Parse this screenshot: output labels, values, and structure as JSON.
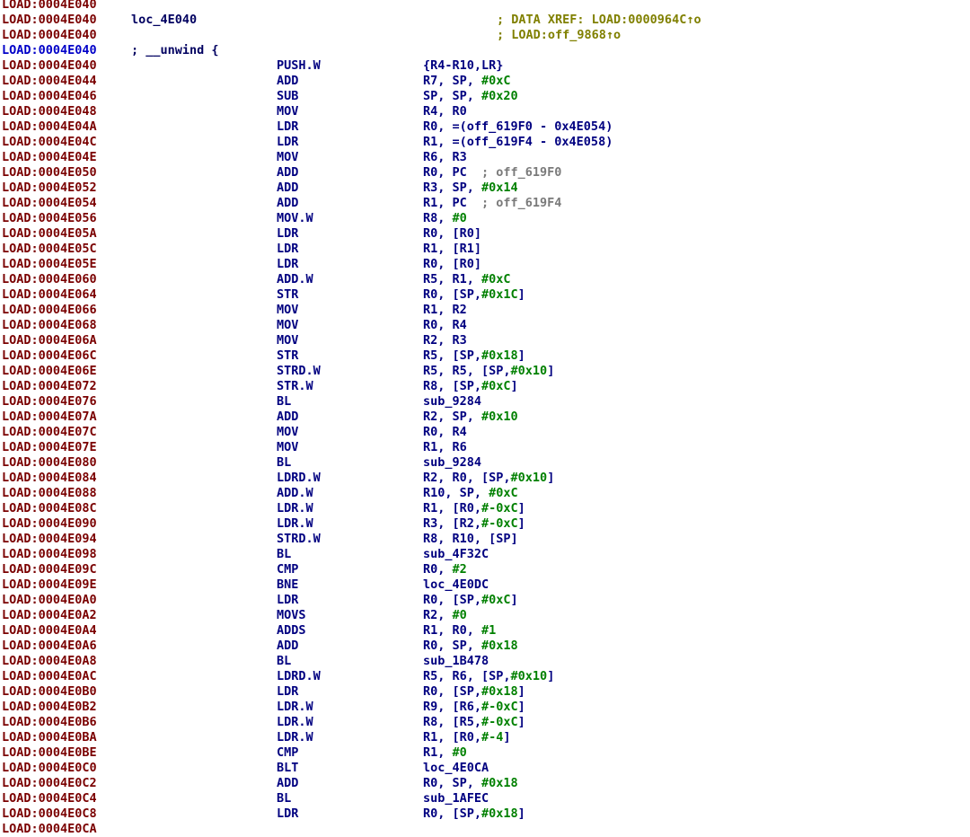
{
  "colors": {
    "address": "#7a0000",
    "address_highlighted": "#0000c8",
    "mnemonic": "#000080",
    "operand": "#000080",
    "immediate": "#008000",
    "comment": "#7a7a7a",
    "xref": "#808000",
    "background": "#ffffff"
  },
  "lines": [
    {
      "addr": "LOAD:0004E040"
    },
    {
      "addr": "LOAD:0004E040",
      "label": "loc_4E040",
      "xref": "; DATA XREF: LOAD:0000964C↑o"
    },
    {
      "addr": "LOAD:0004E040",
      "xref": "; LOAD:off_9868↑o"
    },
    {
      "addr": "LOAD:0004E040",
      "highlight": true,
      "label": "; __unwind {"
    },
    {
      "addr": "LOAD:0004E040",
      "mnem": "PUSH.W",
      "ops": [
        {
          "t": "{R4-R10,LR}"
        }
      ]
    },
    {
      "addr": "LOAD:0004E044",
      "mnem": "ADD",
      "ops": [
        {
          "t": "R7, SP, "
        },
        {
          "t": "#0xC",
          "c": "num"
        }
      ]
    },
    {
      "addr": "LOAD:0004E046",
      "mnem": "SUB",
      "ops": [
        {
          "t": "SP, SP, "
        },
        {
          "t": "#0x20",
          "c": "num"
        }
      ]
    },
    {
      "addr": "LOAD:0004E048",
      "mnem": "MOV",
      "ops": [
        {
          "t": "R4, R0"
        }
      ]
    },
    {
      "addr": "LOAD:0004E04A",
      "mnem": "LDR",
      "ops": [
        {
          "t": "R0, =(off_619F0 - 0x4E054)"
        }
      ]
    },
    {
      "addr": "LOAD:0004E04C",
      "mnem": "LDR",
      "ops": [
        {
          "t": "R1, =(off_619F4 - 0x4E058)"
        }
      ]
    },
    {
      "addr": "LOAD:0004E04E",
      "mnem": "MOV",
      "ops": [
        {
          "t": "R6, R3"
        }
      ]
    },
    {
      "addr": "LOAD:0004E050",
      "mnem": "ADD",
      "ops": [
        {
          "t": "R0, PC  "
        },
        {
          "t": "; off_619F0",
          "c": "cmt"
        }
      ]
    },
    {
      "addr": "LOAD:0004E052",
      "mnem": "ADD",
      "ops": [
        {
          "t": "R3, SP, "
        },
        {
          "t": "#0x14",
          "c": "num"
        }
      ]
    },
    {
      "addr": "LOAD:0004E054",
      "mnem": "ADD",
      "ops": [
        {
          "t": "R1, PC  "
        },
        {
          "t": "; off_619F4",
          "c": "cmt"
        }
      ]
    },
    {
      "addr": "LOAD:0004E056",
      "mnem": "MOV.W",
      "ops": [
        {
          "t": "R8, "
        },
        {
          "t": "#0",
          "c": "num"
        }
      ]
    },
    {
      "addr": "LOAD:0004E05A",
      "mnem": "LDR",
      "ops": [
        {
          "t": "R0, [R0]"
        }
      ]
    },
    {
      "addr": "LOAD:0004E05C",
      "mnem": "LDR",
      "ops": [
        {
          "t": "R1, [R1]"
        }
      ]
    },
    {
      "addr": "LOAD:0004E05E",
      "mnem": "LDR",
      "ops": [
        {
          "t": "R0, [R0]"
        }
      ]
    },
    {
      "addr": "LOAD:0004E060",
      "mnem": "ADD.W",
      "ops": [
        {
          "t": "R5, R1, "
        },
        {
          "t": "#0xC",
          "c": "num"
        }
      ]
    },
    {
      "addr": "LOAD:0004E064",
      "mnem": "STR",
      "ops": [
        {
          "t": "R0, [SP,"
        },
        {
          "t": "#0x1C",
          "c": "num"
        },
        {
          "t": "]"
        }
      ]
    },
    {
      "addr": "LOAD:0004E066",
      "mnem": "MOV",
      "ops": [
        {
          "t": "R1, R2"
        }
      ]
    },
    {
      "addr": "LOAD:0004E068",
      "mnem": "MOV",
      "ops": [
        {
          "t": "R0, R4"
        }
      ]
    },
    {
      "addr": "LOAD:0004E06A",
      "mnem": "MOV",
      "ops": [
        {
          "t": "R2, R3"
        }
      ]
    },
    {
      "addr": "LOAD:0004E06C",
      "mnem": "STR",
      "ops": [
        {
          "t": "R5, [SP,"
        },
        {
          "t": "#0x18",
          "c": "num"
        },
        {
          "t": "]"
        }
      ]
    },
    {
      "addr": "LOAD:0004E06E",
      "mnem": "STRD.W",
      "ops": [
        {
          "t": "R5, R5, [SP,"
        },
        {
          "t": "#0x10",
          "c": "num"
        },
        {
          "t": "]"
        }
      ]
    },
    {
      "addr": "LOAD:0004E072",
      "mnem": "STR.W",
      "ops": [
        {
          "t": "R8, [SP,"
        },
        {
          "t": "#0xC",
          "c": "num"
        },
        {
          "t": "]"
        }
      ]
    },
    {
      "addr": "LOAD:0004E076",
      "mnem": "BL",
      "ops": [
        {
          "t": "sub_9284"
        }
      ]
    },
    {
      "addr": "LOAD:0004E07A",
      "mnem": "ADD",
      "ops": [
        {
          "t": "R2, SP, "
        },
        {
          "t": "#0x10",
          "c": "num"
        }
      ]
    },
    {
      "addr": "LOAD:0004E07C",
      "mnem": "MOV",
      "ops": [
        {
          "t": "R0, R4"
        }
      ]
    },
    {
      "addr": "LOAD:0004E07E",
      "mnem": "MOV",
      "ops": [
        {
          "t": "R1, R6"
        }
      ]
    },
    {
      "addr": "LOAD:0004E080",
      "mnem": "BL",
      "ops": [
        {
          "t": "sub_9284"
        }
      ]
    },
    {
      "addr": "LOAD:0004E084",
      "mnem": "LDRD.W",
      "ops": [
        {
          "t": "R2, R0, [SP,"
        },
        {
          "t": "#0x10",
          "c": "num"
        },
        {
          "t": "]"
        }
      ]
    },
    {
      "addr": "LOAD:0004E088",
      "mnem": "ADD.W",
      "ops": [
        {
          "t": "R10, SP, "
        },
        {
          "t": "#0xC",
          "c": "num"
        }
      ]
    },
    {
      "addr": "LOAD:0004E08C",
      "mnem": "LDR.W",
      "ops": [
        {
          "t": "R1, [R0,"
        },
        {
          "t": "#-0xC",
          "c": "num"
        },
        {
          "t": "]"
        }
      ]
    },
    {
      "addr": "LOAD:0004E090",
      "mnem": "LDR.W",
      "ops": [
        {
          "t": "R3, [R2,"
        },
        {
          "t": "#-0xC",
          "c": "num"
        },
        {
          "t": "]"
        }
      ]
    },
    {
      "addr": "LOAD:0004E094",
      "mnem": "STRD.W",
      "ops": [
        {
          "t": "R8, R10, [SP]"
        }
      ]
    },
    {
      "addr": "LOAD:0004E098",
      "mnem": "BL",
      "ops": [
        {
          "t": "sub_4F32C"
        }
      ]
    },
    {
      "addr": "LOAD:0004E09C",
      "mnem": "CMP",
      "ops": [
        {
          "t": "R0, "
        },
        {
          "t": "#2",
          "c": "num"
        }
      ]
    },
    {
      "addr": "LOAD:0004E09E",
      "mnem": "BNE",
      "ops": [
        {
          "t": "loc_4E0DC"
        }
      ]
    },
    {
      "addr": "LOAD:0004E0A0",
      "mnem": "LDR",
      "ops": [
        {
          "t": "R0, [SP,"
        },
        {
          "t": "#0xC",
          "c": "num"
        },
        {
          "t": "]"
        }
      ]
    },
    {
      "addr": "LOAD:0004E0A2",
      "mnem": "MOVS",
      "ops": [
        {
          "t": "R2, "
        },
        {
          "t": "#0",
          "c": "num"
        }
      ]
    },
    {
      "addr": "LOAD:0004E0A4",
      "mnem": "ADDS",
      "ops": [
        {
          "t": "R1, R0, "
        },
        {
          "t": "#1",
          "c": "num"
        }
      ]
    },
    {
      "addr": "LOAD:0004E0A6",
      "mnem": "ADD",
      "ops": [
        {
          "t": "R0, SP, "
        },
        {
          "t": "#0x18",
          "c": "num"
        }
      ]
    },
    {
      "addr": "LOAD:0004E0A8",
      "mnem": "BL",
      "ops": [
        {
          "t": "sub_1B478"
        }
      ]
    },
    {
      "addr": "LOAD:0004E0AC",
      "mnem": "LDRD.W",
      "ops": [
        {
          "t": "R5, R6, [SP,"
        },
        {
          "t": "#0x10",
          "c": "num"
        },
        {
          "t": "]"
        }
      ]
    },
    {
      "addr": "LOAD:0004E0B0",
      "mnem": "LDR",
      "ops": [
        {
          "t": "R0, [SP,"
        },
        {
          "t": "#0x18",
          "c": "num"
        },
        {
          "t": "]"
        }
      ]
    },
    {
      "addr": "LOAD:0004E0B2",
      "mnem": "LDR.W",
      "ops": [
        {
          "t": "R9, [R6,"
        },
        {
          "t": "#-0xC",
          "c": "num"
        },
        {
          "t": "]"
        }
      ]
    },
    {
      "addr": "LOAD:0004E0B6",
      "mnem": "LDR.W",
      "ops": [
        {
          "t": "R8, [R5,"
        },
        {
          "t": "#-0xC",
          "c": "num"
        },
        {
          "t": "]"
        }
      ]
    },
    {
      "addr": "LOAD:0004E0BA",
      "mnem": "LDR.W",
      "ops": [
        {
          "t": "R1, [R0,"
        },
        {
          "t": "#-4",
          "c": "num"
        },
        {
          "t": "]"
        }
      ]
    },
    {
      "addr": "LOAD:0004E0BE",
      "mnem": "CMP",
      "ops": [
        {
          "t": "R1, "
        },
        {
          "t": "#0",
          "c": "num"
        }
      ]
    },
    {
      "addr": "LOAD:0004E0C0",
      "mnem": "BLT",
      "ops": [
        {
          "t": "loc_4E0CA"
        }
      ]
    },
    {
      "addr": "LOAD:0004E0C2",
      "mnem": "ADD",
      "ops": [
        {
          "t": "R0, SP, "
        },
        {
          "t": "#0x18",
          "c": "num"
        }
      ]
    },
    {
      "addr": "LOAD:0004E0C4",
      "mnem": "BL",
      "ops": [
        {
          "t": "sub_1AFEC"
        }
      ]
    },
    {
      "addr": "LOAD:0004E0C8",
      "mnem": "LDR",
      "ops": [
        {
          "t": "R0, [SP,"
        },
        {
          "t": "#0x18",
          "c": "num"
        },
        {
          "t": "]"
        }
      ]
    },
    {
      "addr": "LOAD:0004E0CA"
    }
  ]
}
